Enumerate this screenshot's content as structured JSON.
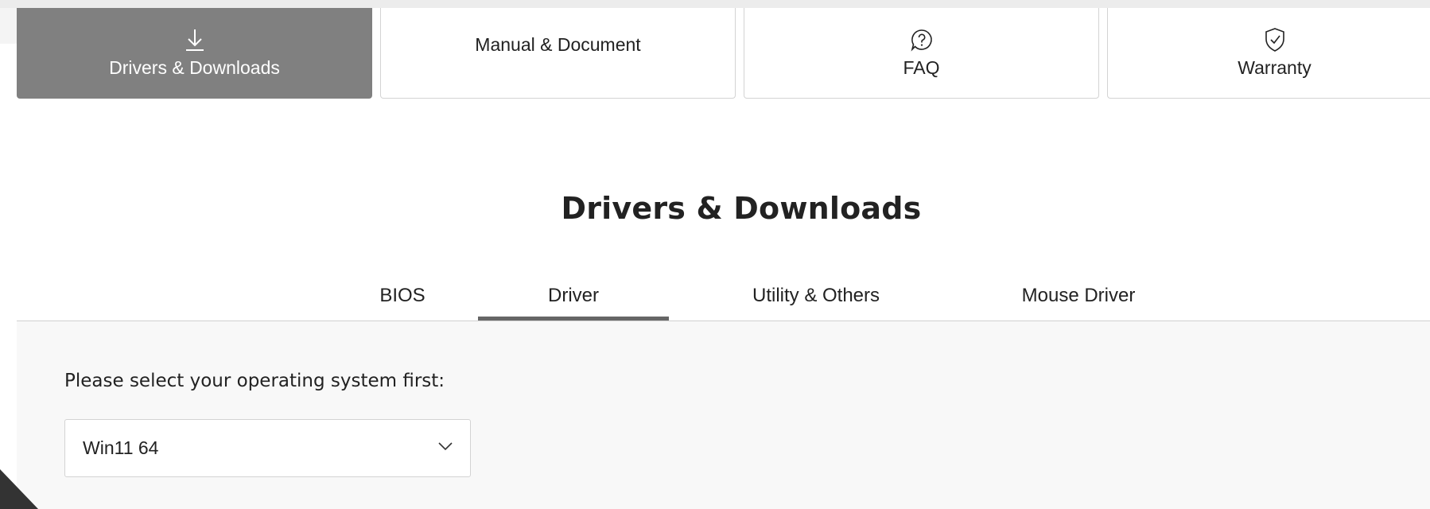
{
  "support_tabs": [
    {
      "label": "Drivers & Downloads",
      "icon": "download-icon",
      "active": true
    },
    {
      "label": "Manual & Document",
      "icon": "",
      "active": false
    },
    {
      "label": "FAQ",
      "icon": "question-bubble-icon",
      "active": false
    },
    {
      "label": "Warranty",
      "icon": "shield-check-icon",
      "active": false
    }
  ],
  "section": {
    "title": "Drivers & Downloads"
  },
  "download_tabs": [
    {
      "label": "BIOS",
      "active": false
    },
    {
      "label": "Driver",
      "active": true
    },
    {
      "label": "Utility & Others",
      "active": false
    },
    {
      "label": "Mouse Driver",
      "active": false
    }
  ],
  "os_selector": {
    "prompt": "Please select your operating system first:",
    "selected": "Win11 64"
  },
  "colors": {
    "active_tab_bg": "#808080",
    "active_underline": "#666666",
    "content_bg": "#f8f8f8",
    "text": "#222222"
  }
}
